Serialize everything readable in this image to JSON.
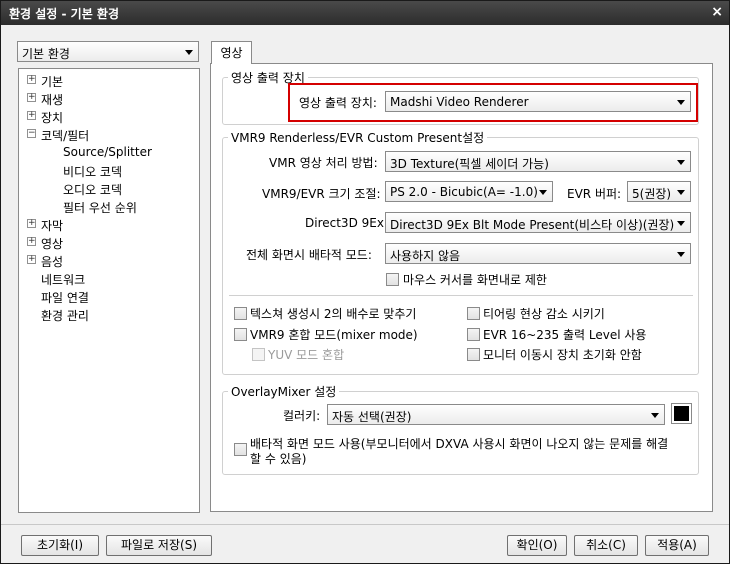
{
  "window": {
    "title": "환경 설정 - 기본 환경",
    "close_glyph": "×"
  },
  "category_select": {
    "value": "기본 환경"
  },
  "tree": {
    "items": [
      {
        "label": "기본",
        "expander": "+"
      },
      {
        "label": "재생",
        "expander": "+"
      },
      {
        "label": "장치",
        "expander": "+"
      },
      {
        "label": "코덱/필터",
        "expander": "−"
      },
      {
        "label": "Source/Splitter"
      },
      {
        "label": "비디오 코덱"
      },
      {
        "label": "오디오 코덱"
      },
      {
        "label": "필터 우선 순위"
      },
      {
        "label": "자막",
        "expander": "+"
      },
      {
        "label": "영상",
        "expander": "+"
      },
      {
        "label": "음성",
        "expander": "+"
      },
      {
        "label": "네트워크"
      },
      {
        "label": "파일 연결"
      },
      {
        "label": "환경 관리"
      }
    ]
  },
  "tab": {
    "label": "영상"
  },
  "output_group": {
    "title": "영상 출력 장치",
    "device_label": "영상 출력 장치:",
    "device_value": "Madshi Video Renderer"
  },
  "vmr_group": {
    "title": "VMR9 Renderless/EVR Custom Present설정",
    "processing_label": "VMR 영상 처리 방법:",
    "processing_value": "3D Texture(픽셀 세이더 가능)",
    "resize_label": "VMR9/EVR 크기 조절:",
    "resize_value": "PS 2.0 - Bicubic(A= -1.0)",
    "evr_buffer_label": "EVR 버퍼:",
    "evr_buffer_value": "5(권장)",
    "d3d_label": "Direct3D 9Ex:",
    "d3d_value": "Direct3D 9Ex Blt Mode Present(비스타 이상)(권장)",
    "fullscreen_label": "전체 화면시 배타적 모드:",
    "fullscreen_value": "사용하지 않음",
    "mouse_limit_label": "마우스 커서를 화면내로 제한",
    "options_left": [
      "텍스쳐 생성시 2의 배수로 맞추기",
      "VMR9 혼합 모드(mixer mode)",
      "YUV 모드 혼합"
    ],
    "options_right": [
      "티어링 현상 감소 시키기",
      "EVR 16~235 출력 Level 사용",
      "모니터 이동시 장치 초기화 안함"
    ]
  },
  "overlay_group": {
    "title": "OverlayMixer 설정",
    "colorkey_label": "컬러키:",
    "colorkey_value": "자동 선택(권장)",
    "colorkey_color": "#000000",
    "exclusive_line1": "배타적 화면 모드 사용(부모니터에서 DXVA 사용시 화면이 나오지 않는 문제를 해결",
    "exclusive_line2": "할 수 있음)"
  },
  "buttons": {
    "reset": "초기화(I)",
    "save_file": "파일로 저장(S)",
    "ok": "확인(O)",
    "cancel": "취소(C)",
    "apply": "적용(A)"
  },
  "colors": {
    "highlight_border": "#d40000"
  }
}
